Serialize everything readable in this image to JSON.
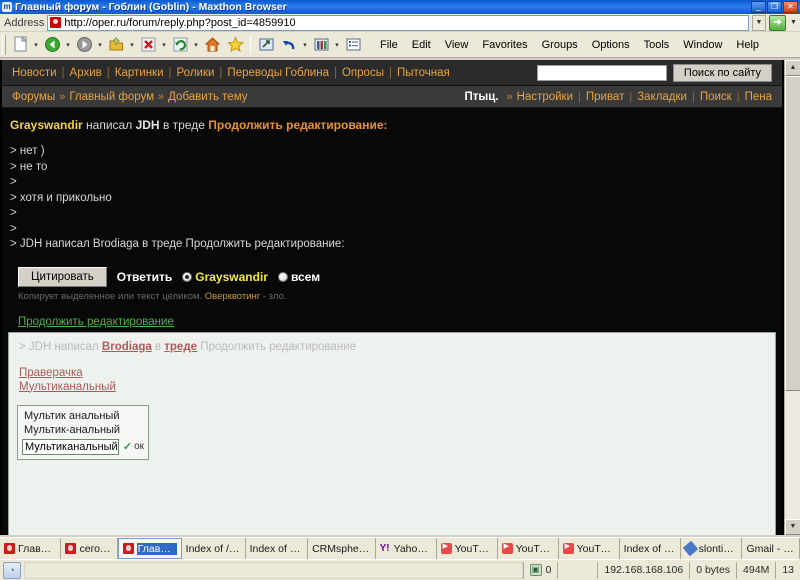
{
  "window": {
    "title": "Главный форум - Гоблин (Goblin) - Maxthon Browser",
    "icon": "maxthon-icon",
    "minimize": "_",
    "restore": "❐",
    "close": "✕"
  },
  "address": {
    "label": "Address",
    "url": "http://oper.ru/forum/reply.php?post_id=4859910",
    "dropdown": "▼",
    "go": "➜",
    "go_dropdown": "▼"
  },
  "toolbar": {
    "icons": [
      {
        "name": "new-page-icon",
        "glyph": "📄",
        "caret": true
      },
      {
        "name": "back-icon",
        "glyph": "◀",
        "caret": true
      },
      {
        "name": "forward-icon",
        "glyph": "▶",
        "caret": true
      },
      {
        "name": "open-folder-icon",
        "glyph": "📂",
        "caret": true
      },
      {
        "name": "stop-icon",
        "glyph": "✖",
        "caret": true
      },
      {
        "name": "refresh-icon",
        "glyph": "⟳",
        "caret": true
      },
      {
        "name": "home-icon",
        "glyph": "🏠",
        "caret": false
      },
      {
        "name": "favorites-star-icon",
        "glyph": "★",
        "caret": false
      },
      {
        "name": "fullscreen-icon",
        "glyph": "⬈",
        "caret": false
      },
      {
        "name": "undo-icon",
        "glyph": "↩",
        "caret": true
      },
      {
        "name": "tools-icon",
        "glyph": "🛠",
        "caret": true
      },
      {
        "name": "list-icon",
        "glyph": "☰",
        "caret": false
      }
    ]
  },
  "menu": {
    "items": [
      "File",
      "Edit",
      "View",
      "Favorites",
      "Groups",
      "Options",
      "Tools",
      "Window",
      "Help"
    ]
  },
  "site": {
    "nav": [
      "Новости",
      "Архив",
      "Картинки",
      "Ролики",
      "Переводы Гоблина",
      "Опросы",
      "Пыточная"
    ],
    "search_placeholder": "",
    "search_value": "",
    "search_button": "Поиск по сайту",
    "breadcrumb": [
      "Форумы",
      "Главный форум",
      "Добавить тему"
    ],
    "breadcrumb_arrow": "»",
    "user": "Птыц.",
    "user_arrow": "»",
    "user_links": [
      "Настройки",
      "Приват",
      "Закладки",
      "Поиск",
      "Пена"
    ]
  },
  "post": {
    "author": "Grayswandir",
    "verb": "написал",
    "target": "JDH",
    "in_thread": "в треде",
    "thread": "Продолжить редактирование:",
    "quote_lines": [
      "> нет )",
      "> не то",
      ">",
      "> хотя и прикольно",
      ">",
      ">",
      "> JDH написал Brodiaga в треде Продолжить редактирование:"
    ]
  },
  "reply": {
    "quote_button": "Цитировать",
    "label": "Ответить",
    "options": [
      {
        "label": "Grayswandir",
        "selected": true
      },
      {
        "label": "всем",
        "selected": false
      }
    ],
    "hint_prefix": "Копирует выделенное или текст целиком. ",
    "hint_highlight": "Оверквотинг",
    "hint_suffix": " - зло.",
    "subject_link": "Продолжить редактирование"
  },
  "editor": {
    "quote_prefix": "> JDH написал ",
    "quote_link1": "Brodiaga",
    "quote_mid": " в ",
    "quote_link2": "треде",
    "quote_suffix": " Продолжить редактирование",
    "line1": "Праверачка",
    "line2": "Мультиканальный"
  },
  "spellcheck": {
    "suggestions": [
      "Мультик анальный",
      "Мультик-анальный"
    ],
    "input_value": "Мультиканальный",
    "check_glyph": "✓",
    "ok_label": "ок"
  },
  "scrollbar": {
    "up_arrow": "▲",
    "down_arrow": "▼"
  },
  "tabs": [
    {
      "label": "Главный ...",
      "icon": "oper-icon",
      "active": false
    },
    {
      "label": "сегодня...",
      "icon": "oper-icon",
      "active": false
    },
    {
      "label": "Главный ...",
      "icon": "oper-icon",
      "active": true
    },
    {
      "label": "Index of /Music",
      "icon": "blank-icon",
      "active": false
    },
    {
      "label": "Index of /Mus..",
      "icon": "blank-icon",
      "active": false
    },
    {
      "label": "CRMsphere™...",
      "icon": "blank-icon",
      "active": false
    },
    {
      "label": "Yahoo! M...",
      "icon": "yahoo-icon",
      "active": false
    },
    {
      "label": "YouTube ...",
      "icon": "youtube-icon",
      "active": false
    },
    {
      "label": "YouTube ...",
      "icon": "youtube-icon",
      "active": false
    },
    {
      "label": "YouTube ...",
      "icon": "youtube-icon",
      "active": false
    },
    {
      "label": "Index of /Vid...",
      "icon": "blank-icon",
      "active": false
    },
    {
      "label": "slontik's F...",
      "icon": "pen-icon",
      "active": false
    },
    {
      "label": "Gmail - Inbox",
      "icon": "blank-icon",
      "active": false
    }
  ],
  "status": {
    "left_icon": "page-icon",
    "block_icon": "blocked-popup-icon",
    "block_count": "0",
    "ip": "192.168.168.106",
    "transferred": "0 bytes",
    "memory": "494M",
    "counter": "13"
  }
}
